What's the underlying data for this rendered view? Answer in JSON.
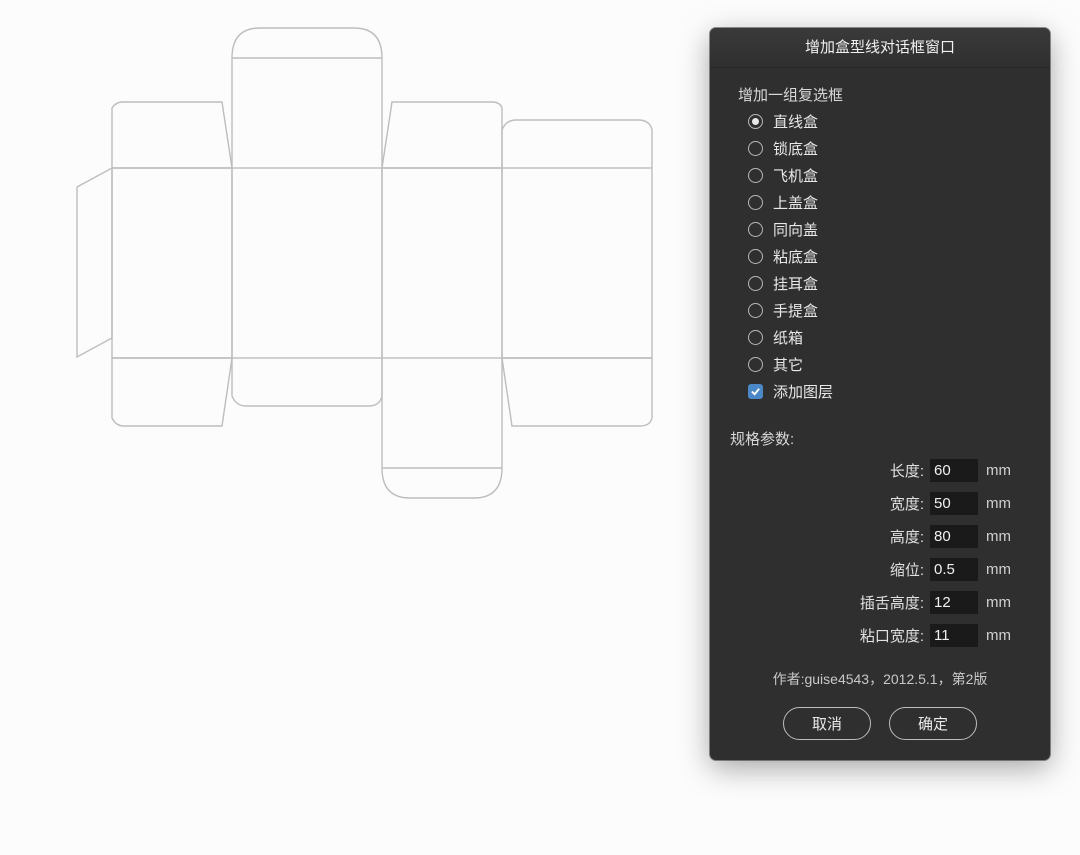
{
  "dialog": {
    "title": "增加盒型线对话框窗口",
    "group_label": "增加一组复选框",
    "options": [
      {
        "label": "直线盒",
        "selected": true
      },
      {
        "label": "锁底盒",
        "selected": false
      },
      {
        "label": "飞机盒",
        "selected": false
      },
      {
        "label": "上盖盒",
        "selected": false
      },
      {
        "label": "同向盖",
        "selected": false
      },
      {
        "label": "粘底盒",
        "selected": false
      },
      {
        "label": "挂耳盒",
        "selected": false
      },
      {
        "label": "手提盒",
        "selected": false
      },
      {
        "label": "纸箱",
        "selected": false
      },
      {
        "label": "其它",
        "selected": false
      }
    ],
    "add_layer_label": "添加图层",
    "add_layer_checked": true,
    "params_label": "规格参数:",
    "params": [
      {
        "label": "长度:",
        "value": "60",
        "unit": "mm"
      },
      {
        "label": "宽度:",
        "value": "50",
        "unit": "mm"
      },
      {
        "label": "高度:",
        "value": "80",
        "unit": "mm"
      },
      {
        "label": "缩位:",
        "value": "0.5",
        "unit": "mm"
      },
      {
        "label": "插舌高度:",
        "value": "12",
        "unit": "mm"
      },
      {
        "label": "粘口宽度:",
        "value": "11",
        "unit": "mm"
      }
    ],
    "footer": "作者:guise4543，2012.5.1，第2版",
    "cancel_label": "取消",
    "ok_label": "确定"
  }
}
